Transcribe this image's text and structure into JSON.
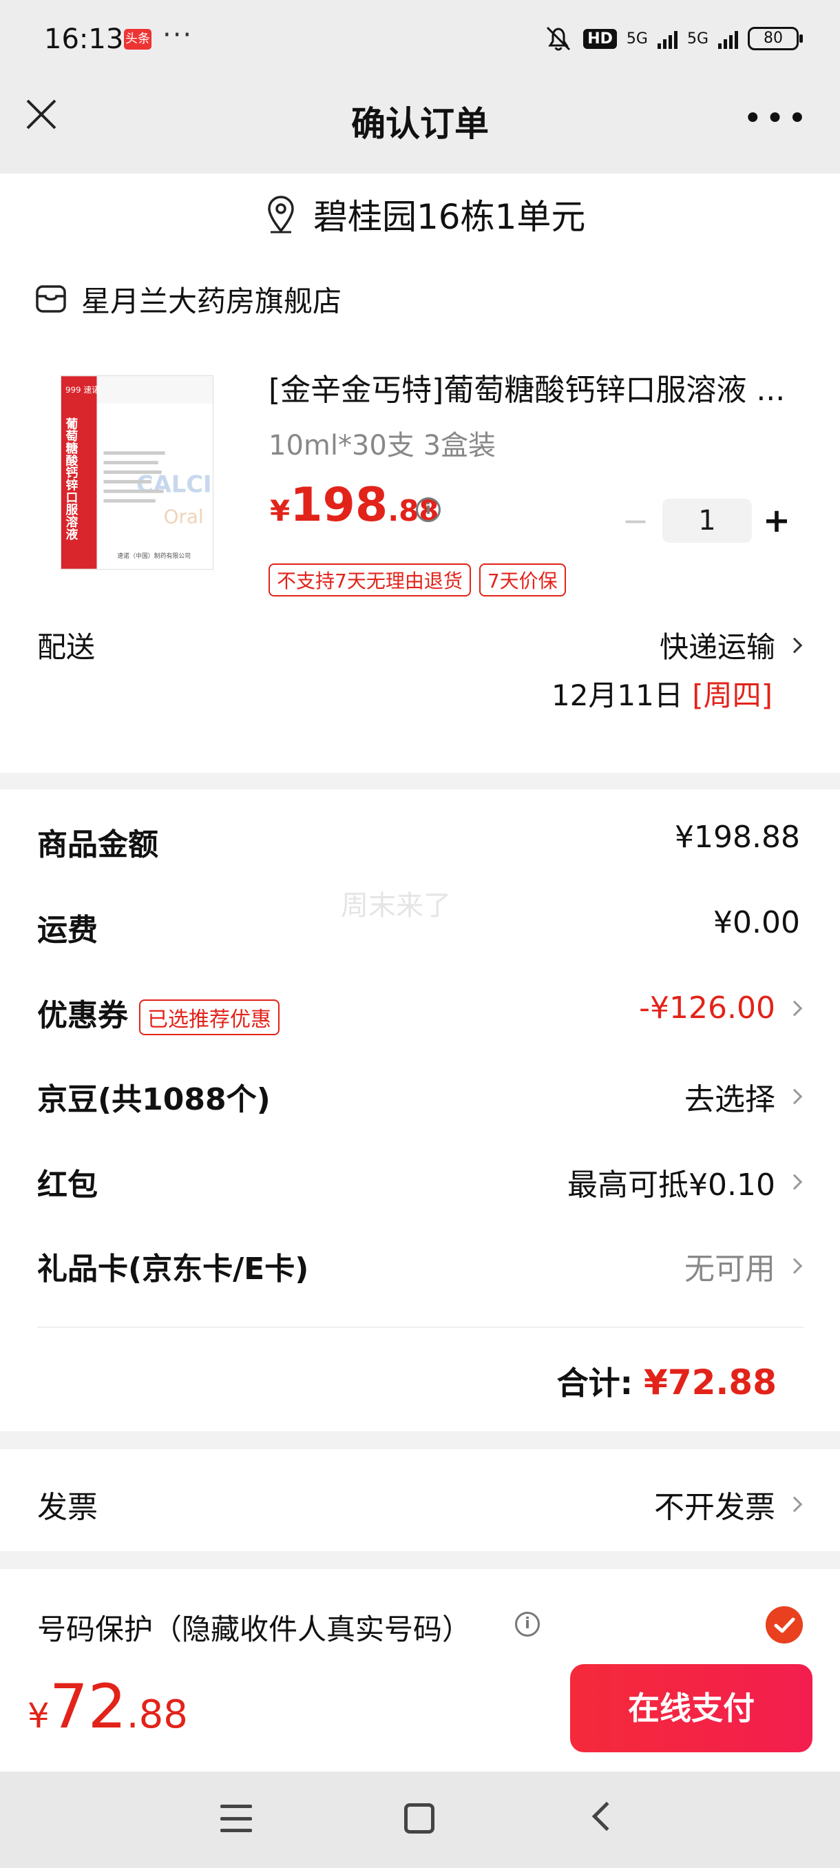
{
  "status_bar": {
    "time": "16:13",
    "app_badge": "头条",
    "more": "···",
    "hd": "HD",
    "net1": "5G",
    "net2": "5G",
    "battery": "80"
  },
  "header": {
    "title": "确认订单"
  },
  "address": {
    "text": "碧桂园16栋1单元"
  },
  "store": {
    "name": "星月兰大药房旗舰店"
  },
  "product": {
    "title": "[金辛金丐特]葡萄糖酸钙锌口服溶液 ...",
    "spec": "10ml*30支 3盒装",
    "price_currency": "¥",
    "price_int": "198",
    "price_dec": ".88",
    "quantity": "1",
    "minus": "−",
    "plus": "+",
    "tags": [
      "不支持7天无理由退货",
      "7天价保"
    ],
    "image_text": {
      "brand": "999 速诺",
      "name": "葡萄糖酸钙锌口服溶液",
      "latin": "CALCI",
      "oral": "Oral",
      "maker": "速诺（中国）制药有限公司"
    }
  },
  "delivery": {
    "label": "配送",
    "method": "快递运输",
    "date": "12月11日",
    "weekday": "[周四]"
  },
  "fees": {
    "watermark": "周末来了",
    "goods_label": "商品金额",
    "goods_value": "¥198.88",
    "shipping_label": "运费",
    "shipping_value": "¥0.00",
    "coupon_label": "优惠券",
    "coupon_tag": "已选推荐优惠",
    "coupon_value": "-¥126.00",
    "jingdou_label": "京豆(共1088个)",
    "jingdou_value": "去选择",
    "redpacket_label": "红包",
    "redpacket_value": "最高可抵¥0.10",
    "giftcard_label": "礼品卡(京东卡/E卡)",
    "giftcard_value": "无可用",
    "total_label": "合计:",
    "total_value": "¥72.88"
  },
  "invoice": {
    "label": "发票",
    "value": "不开发票"
  },
  "phone_protect": {
    "label": "号码保护（隐藏收件人真实号码）",
    "checked": true
  },
  "pay_bar": {
    "currency": "¥",
    "int": "72",
    "dec": ".88",
    "button": "在线支付"
  },
  "colors": {
    "accent_red": "#e2231a",
    "pay_button": "#f42a3a",
    "check": "#e9401f"
  }
}
